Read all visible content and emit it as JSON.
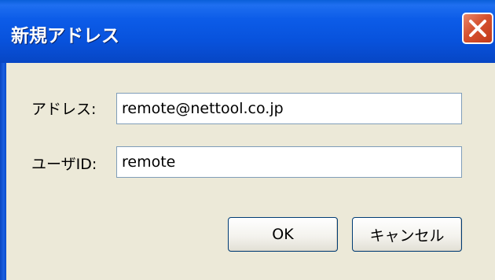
{
  "window": {
    "title": "新規アドレス",
    "close_icon": "close-icon"
  },
  "form": {
    "address": {
      "label": "アドレス:",
      "value": "remote@nettool.co.jp"
    },
    "user_id": {
      "label": "ユーザID:",
      "value": "remote"
    }
  },
  "buttons": {
    "ok_label": "OK",
    "cancel_label": "キャンセル"
  },
  "colors": {
    "titlebar": "#0852dc",
    "close_button": "#d5522f",
    "dialog_background": "#ece9d8",
    "field_border": "#7f9db9"
  }
}
